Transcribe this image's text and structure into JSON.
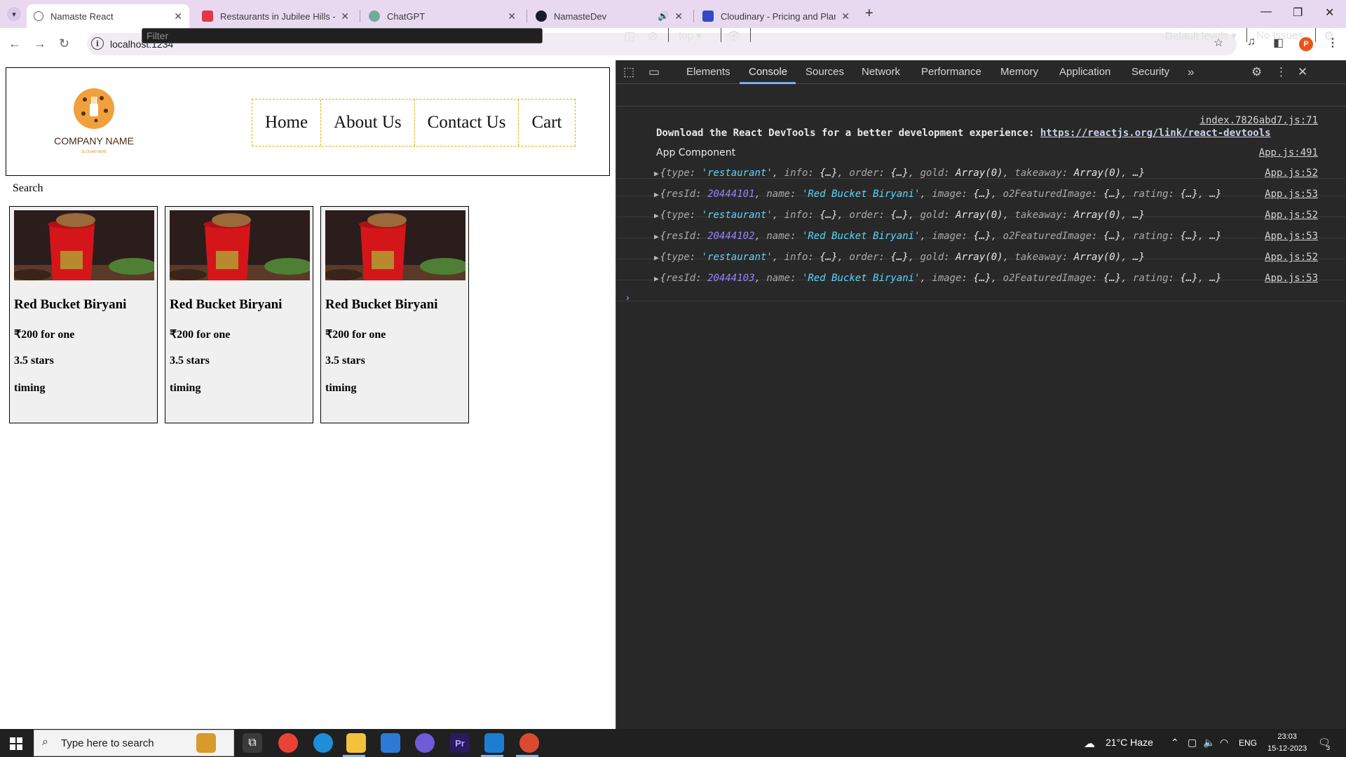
{
  "browser": {
    "tabs": [
      {
        "title": "Namaste React",
        "active": true,
        "favicon_color": "#5f6368"
      },
      {
        "title": "Restaurants in Jubilee Hills - Zomato",
        "active": false,
        "favicon_color": "#e23744"
      },
      {
        "title": "ChatGPT",
        "active": false,
        "favicon_color": "#74aa9c"
      },
      {
        "title": "NamasteDev",
        "active": false,
        "favicon_color": "#1a1a2e"
      },
      {
        "title": "Cloudinary - Pricing and Plans",
        "active": false,
        "favicon_color": "#3448c5"
      }
    ],
    "url": "localhost:1234",
    "profile_initial": "P"
  },
  "page": {
    "logo_text": "COMPANY NAME",
    "logo_tagline": "SLOGAN HERE",
    "nav": [
      "Home",
      "About Us",
      "Contact Us",
      "Cart"
    ],
    "search_label": "Search",
    "cards": [
      {
        "name": "Red Bucket Biryani",
        "price": "₹200 for one",
        "rating": "3.5 stars",
        "timing": "timing"
      },
      {
        "name": "Red Bucket Biryani",
        "price": "₹200 for one",
        "rating": "3.5 stars",
        "timing": "timing"
      },
      {
        "name": "Red Bucket Biryani",
        "price": "₹200 for one",
        "rating": "3.5 stars",
        "timing": "timing"
      }
    ]
  },
  "devtools": {
    "tabs": [
      "Elements",
      "Console",
      "Sources",
      "Network",
      "Performance",
      "Memory",
      "Application",
      "Security"
    ],
    "active_tab": "Console",
    "context": "top",
    "filter_placeholder": "Filter",
    "levels": "Default levels",
    "issues": "No Issues",
    "logs": {
      "banner_src": "index.7826abd7.js:71",
      "banner_text": "Download the React DevTools for a better development experience: ",
      "banner_link": "https://reactjs.org/link/react-devtools",
      "app_text": "App Component",
      "app_src": "App.js:491",
      "rows": [
        {
          "src": "App.js:52"
        },
        {
          "src": "App.js:53",
          "resId": "20444101"
        },
        {
          "src": "App.js:52"
        },
        {
          "src": "App.js:53",
          "resId": "20444102"
        },
        {
          "src": "App.js:52"
        },
        {
          "src": "App.js:53",
          "resId": "20444103"
        }
      ],
      "type_obj": {
        "k1": "type",
        "v1": "'restaurant'",
        "k2": "info",
        "v2": "{…}",
        "k3": "order",
        "v3": "{…}",
        "k4": "gold",
        "v4": "Array(0)",
        "k5": "takeaway",
        "v5": "Array(0)",
        "tail": "…}"
      },
      "res_obj": {
        "k1": "resId",
        "k2": "name",
        "v2": "'Red Bucket Biryani'",
        "k3": "image",
        "v3": "{…}",
        "k4": "o2FeaturedImage",
        "v4": "{…}",
        "k5": "rating",
        "v5": "{…}",
        "tail": "…}"
      }
    }
  },
  "taskbar": {
    "search_placeholder": "Type here to search",
    "weather": "21°C  Haze",
    "lang": "ENG",
    "time": "23:03",
    "date": "15-12-2023",
    "notifications": "3"
  }
}
